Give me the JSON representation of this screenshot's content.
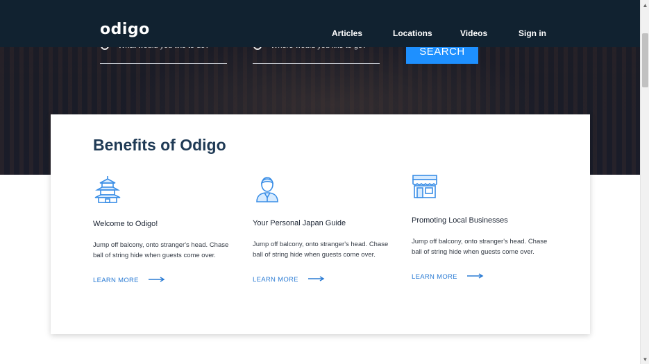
{
  "brand": {
    "logo": "odigo"
  },
  "nav": {
    "items": [
      {
        "label": "Articles"
      },
      {
        "label": "Locations"
      },
      {
        "label": "Videos"
      },
      {
        "label": "Sign in"
      }
    ]
  },
  "search": {
    "what_placeholder": "What would you like to do?",
    "where_placeholder": "Where would you like to go?",
    "button_label": "SEARCH"
  },
  "benefits": {
    "title": "Benefits of Odigo",
    "items": [
      {
        "icon": "pagoda-icon",
        "title": "Welcome to Odigo!",
        "description": "Jump off balcony, onto stranger's head. Chase ball of string hide when guests come over.",
        "link": "LEARN MORE"
      },
      {
        "icon": "person-guide-icon",
        "title": "Your Personal Japan Guide",
        "description": "Jump off balcony, onto stranger's head. Chase ball of string hide when guests come over.",
        "link": "LEARN MORE"
      },
      {
        "icon": "storefront-icon",
        "title": "Promoting Local Businesses",
        "description": "Jump off balcony, onto stranger's head. Chase ball of string hide when guests come over.",
        "link": "LEARN MORE"
      }
    ]
  },
  "colors": {
    "header_bg": "#112230",
    "accent": "#1e90ff",
    "link": "#2a7bd4",
    "title": "#1f3a55"
  }
}
